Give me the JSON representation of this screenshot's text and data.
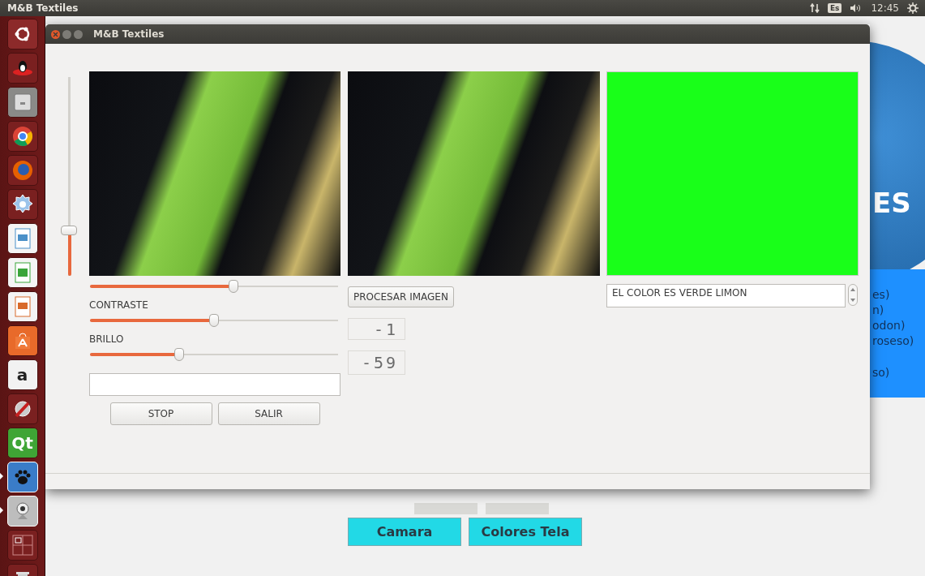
{
  "top_panel": {
    "title": "M&B Textiles",
    "keyboard_layout": "Es",
    "clock": "12:45"
  },
  "launcher": [
    {
      "kind": "dash",
      "running": false,
      "focused": false
    },
    {
      "kind": "game",
      "running": false,
      "focused": false
    },
    {
      "kind": "files",
      "running": false,
      "focused": false
    },
    {
      "kind": "chrome",
      "running": false,
      "focused": false
    },
    {
      "kind": "firefox",
      "running": false,
      "focused": false
    },
    {
      "kind": "gear",
      "running": false,
      "focused": false
    },
    {
      "kind": "writer",
      "running": false,
      "focused": false
    },
    {
      "kind": "calc",
      "running": false,
      "focused": false
    },
    {
      "kind": "impress",
      "running": false,
      "focused": false
    },
    {
      "kind": "store",
      "running": false,
      "focused": false
    },
    {
      "kind": "amazon",
      "label": "a",
      "running": false,
      "focused": false
    },
    {
      "kind": "tools",
      "running": false,
      "focused": false
    },
    {
      "kind": "qt",
      "label": "Qt",
      "running": false,
      "focused": false
    },
    {
      "kind": "paw",
      "running": true,
      "focused": true
    },
    {
      "kind": "webcam",
      "running": true,
      "focused": false
    },
    {
      "kind": "workspaces",
      "running": false,
      "focused": false
    },
    {
      "kind": "trash",
      "running": false,
      "focused": false
    }
  ],
  "background_window": {
    "logo_text": "ES",
    "list_lines": [
      "es)",
      "n)",
      "odon)",
      "roseso)",
      "so)"
    ],
    "buttons": [
      "Camara",
      "Colores Tela"
    ]
  },
  "window": {
    "title": "M&B Textiles",
    "vertical_slider": {
      "level": 0.23
    },
    "top_slider": {
      "level": 0.58
    },
    "sliders": [
      {
        "label": "CONTRASTE",
        "level": 0.5
      },
      {
        "label": "BRILLO",
        "level": 0.36
      }
    ],
    "buttons": [
      "STOP",
      "SALIR"
    ],
    "process_button": "PROCESAR IMAGEN",
    "lcd_readings": [
      "-1",
      "-59"
    ],
    "color_swatch": {
      "color": "#19ff19"
    },
    "result_field": {
      "value": "EL COLOR ES VERDE LIMON"
    }
  }
}
